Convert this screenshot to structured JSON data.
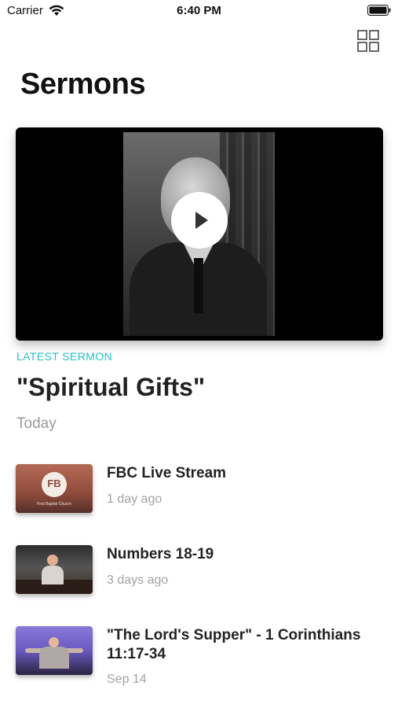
{
  "status_bar": {
    "carrier": "Carrier",
    "time": "6:40 PM"
  },
  "header": {
    "title": "Sermons"
  },
  "hero": {
    "label": "LATEST SERMON",
    "title": "\"Spiritual Gifts\"",
    "date": "Today"
  },
  "sermons": [
    {
      "title": "FBC Live Stream",
      "date": "1 day ago",
      "thumb_text": "FB",
      "thumb_caption": "First Baptist Church"
    },
    {
      "title": "Numbers 18-19",
      "date": "3 days ago"
    },
    {
      "title": "\"The Lord's Supper\" - 1 Corinthians 11:17-34",
      "date": "Sep 14"
    }
  ],
  "colors": {
    "accent": "#26c0c7",
    "text": "#222222",
    "muted": "#9a9a9a"
  },
  "icons": [
    "wifi-icon",
    "battery-icon",
    "grid-icon",
    "play-icon"
  ]
}
